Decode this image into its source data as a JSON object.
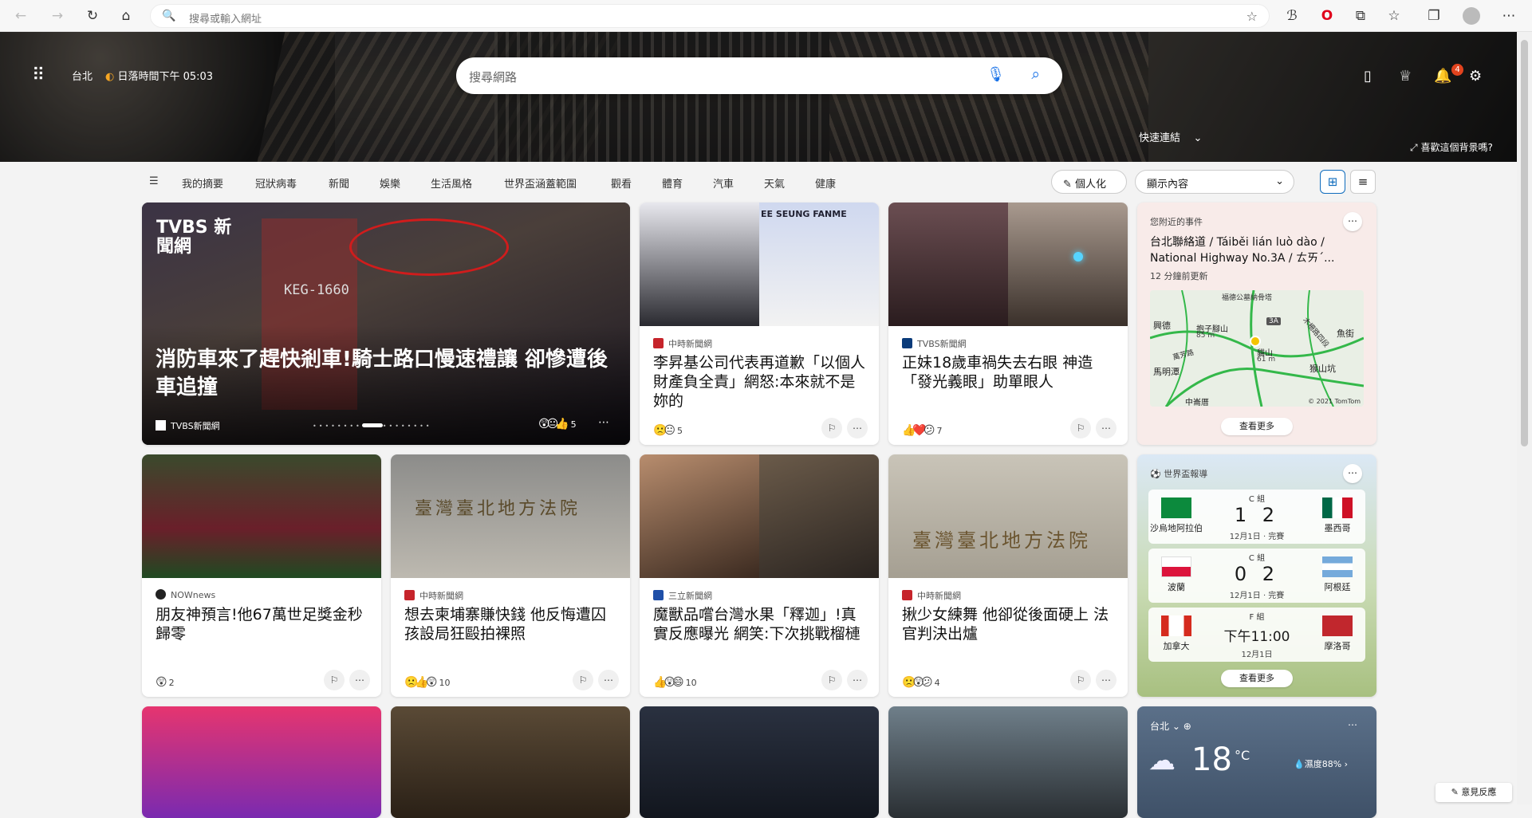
{
  "browser": {
    "url_placeholder": "搜尋或輸入網址"
  },
  "header": {
    "location": "台北",
    "sunset": "日落時間下午 05:03",
    "search_placeholder": "搜尋網路",
    "notification_count": "4",
    "quick_links": "快速連結",
    "like_background": "喜歡這個背景嗎?"
  },
  "nav": {
    "items": [
      "我的摘要",
      "冠狀病毒",
      "新聞",
      "娛樂",
      "生活風格",
      "世界盃涵蓋範圍",
      "觀看",
      "體育",
      "汽車",
      "天氣",
      "健康"
    ],
    "personalize": "個人化",
    "show_content": "顯示內容"
  },
  "hero_article": {
    "source": "TVBS新聞網",
    "title": "消防車來了趕快剎車!騎士路口慢速禮讓 卻慘遭後車追撞",
    "reactions": "5",
    "watermark": "TVBS 新聞網",
    "plate": "KEG-1660"
  },
  "articles": [
    {
      "source": "中時新聞網",
      "title": "李昇基公司代表再道歉「以個人財產負全責」網怒:本來就不是妳的",
      "reactions": "5",
      "emoji": "🙁😐",
      "banner": "EE SEUNG FANME"
    },
    {
      "source": "TVBS新聞網",
      "title": "正妹18歲車禍失去右眼 神造「發光義眼」助單眼人",
      "reactions": "7",
      "emoji": "👍❤️😕"
    },
    {
      "source": "NOWnews",
      "title": "朋友神預言!他67萬世足獎金秒歸零",
      "reactions": "2",
      "emoji": "😲"
    },
    {
      "source": "中時新聞網",
      "title": "想去柬埔寨賺快錢 他反悔遭囚孩設局狂毆拍裸照",
      "reactions": "10",
      "emoji": "🙁👍😲",
      "sign": "臺灣臺北地方法院"
    },
    {
      "source": "三立新聞網",
      "title": "魔獸品嚐台灣水果「釋迦」!真實反應曝光 網笑:下次挑戰榴槤",
      "reactions": "10",
      "emoji": "👍😲😄"
    },
    {
      "source": "中時新聞網",
      "title": "揪少女練舞 他卻從後面硬上 法官判決出爐",
      "reactions": "4",
      "emoji": "🙁😲😕",
      "sign": "臺灣臺北地方法院"
    }
  ],
  "traffic_widget": {
    "header": "您附近的事件",
    "title": "台北聯絡道 / Táiběi lián luò dào / National Highway No.3A / ㄊㄞˊ...",
    "updated": "12 分鐘前更新",
    "map_labels": [
      "福德公墓納骨塔",
      "興德",
      "抱子腳山",
      "85 m",
      "魚街",
      "木柵路四段",
      "萬芳路",
      "貓山",
      "61 m",
      "猴山坑",
      "馬明潭",
      "中崙厝",
      "3A"
    ],
    "copyright": "© 2021 TomTom",
    "see_more": "查看更多"
  },
  "worldcup_widget": {
    "header": "世界盃報導",
    "matches": [
      {
        "group": "C 組",
        "home": "沙烏地阿拉伯",
        "away": "墨西哥",
        "score": "1 2",
        "date": "12月1日 · 完賽"
      },
      {
        "group": "C 組",
        "home": "波蘭",
        "away": "阿根廷",
        "score": "0 2",
        "date": "12月1日 · 完賽"
      },
      {
        "group": "F 組",
        "home": "加拿大",
        "away": "摩洛哥",
        "score": "下午11:00",
        "date": "12月1日"
      }
    ],
    "see_more": "查看更多"
  },
  "weather_widget": {
    "location": "台北",
    "temp": "18",
    "unit": "°C",
    "humidity": "濕度88%"
  },
  "feedback": "意見反應",
  "colors": {
    "accent": "#0f6cbd",
    "badge": "#e2431e"
  }
}
